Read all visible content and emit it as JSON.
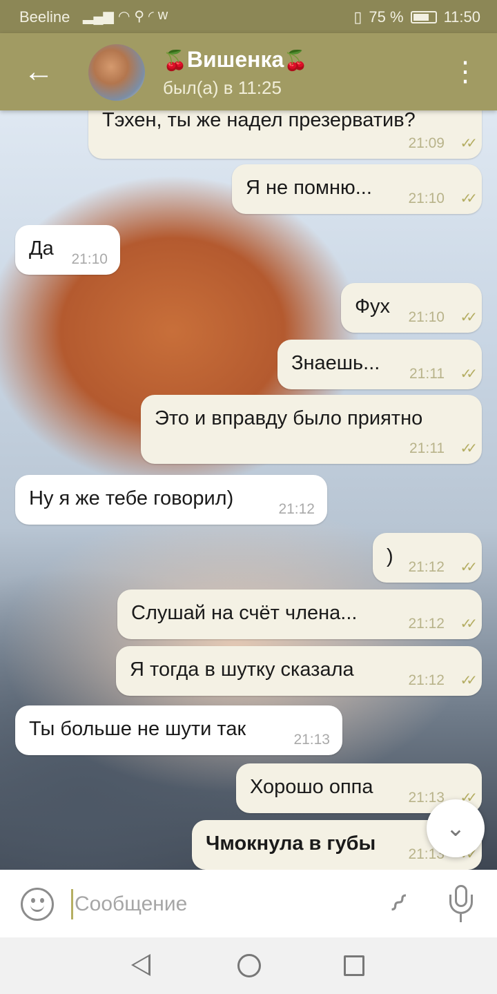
{
  "status_bar": {
    "carrier": "Beeline",
    "battery": "75 %",
    "battery_level": 0.75,
    "time": "11:50"
  },
  "header": {
    "back_icon": "arrow-left-icon",
    "contact_name": "Вишенка",
    "name_decoration": "🍒",
    "last_seen": "был(а) в 11:25",
    "menu_icon": "more-vertical-icon"
  },
  "messages": [
    {
      "dir": "out",
      "text": "Тэхен, ты же надел презерватив?",
      "time": "21:09",
      "status": "read"
    },
    {
      "dir": "out",
      "text": "Я не помню...",
      "time": "21:10",
      "status": "read"
    },
    {
      "dir": "in",
      "text": "Да",
      "time": "21:10"
    },
    {
      "dir": "out",
      "text": "Фух",
      "time": "21:10",
      "status": "read"
    },
    {
      "dir": "out",
      "text": "Знаешь...",
      "time": "21:11",
      "status": "read"
    },
    {
      "dir": "out",
      "text": "Это и вправду было приятно",
      "time": "21:11",
      "status": "read"
    },
    {
      "dir": "in",
      "text": "Ну я же тебе говорил)",
      "time": "21:12"
    },
    {
      "dir": "out",
      "text": ")",
      "time": "21:12",
      "status": "read"
    },
    {
      "dir": "out",
      "text": "Слушай на счёт члена...",
      "time": "21:12",
      "status": "read"
    },
    {
      "dir": "out",
      "text": "Я тогда в шутку сказала",
      "time": "21:12",
      "status": "read"
    },
    {
      "dir": "in",
      "text": "Ты больше не шути так",
      "time": "21:13"
    },
    {
      "dir": "out",
      "text": "Хорошо оппа",
      "time": "21:13",
      "status": "read"
    },
    {
      "dir": "out",
      "text": "Чмокнула в губы",
      "time": "21:13",
      "status": "read",
      "bold": true
    }
  ],
  "input": {
    "placeholder": "Сообщение",
    "value": ""
  },
  "colors": {
    "header": "#a19b63",
    "status_bar": "#8c8756",
    "bubble_out": "#f4f1e4",
    "bubble_in": "#ffffff",
    "check": "#b4ad62"
  }
}
